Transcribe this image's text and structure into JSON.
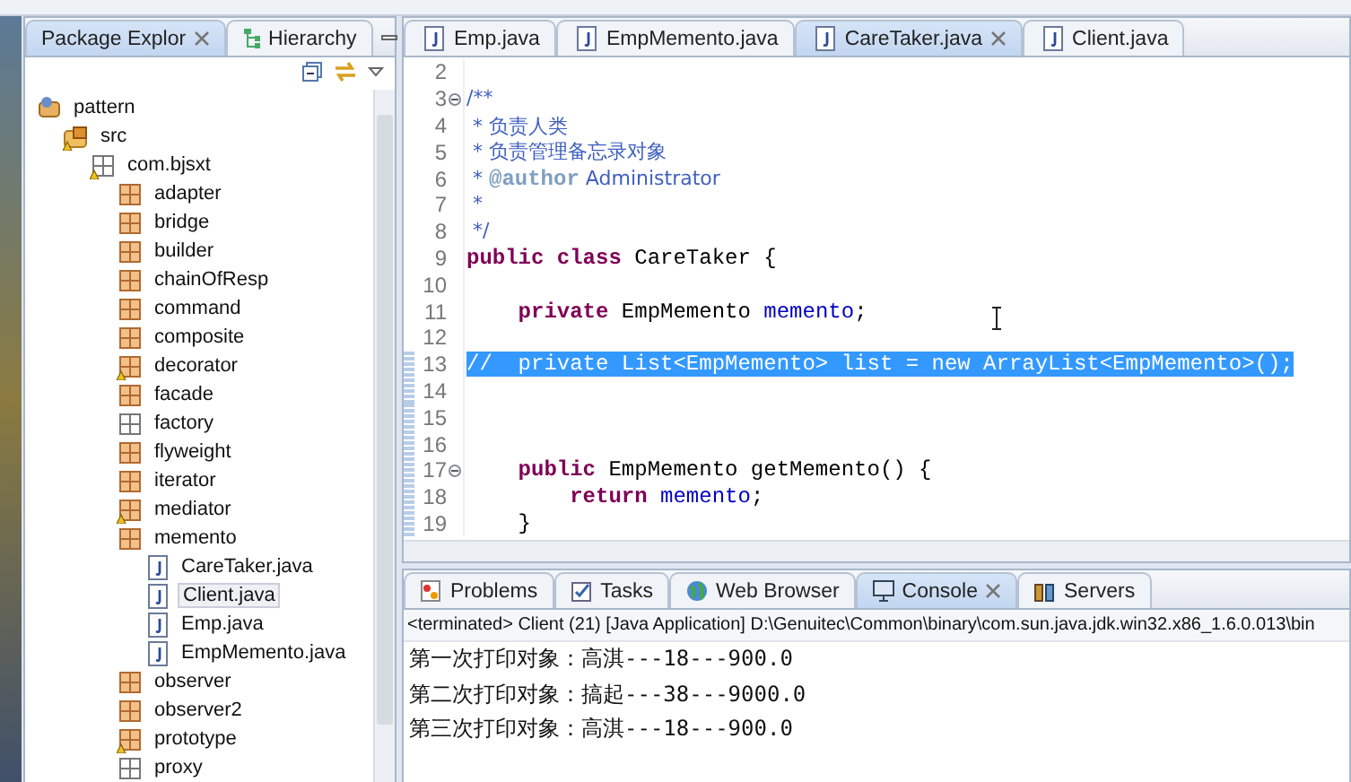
{
  "explorer": {
    "tabs": [
      {
        "label": "Package Explor",
        "selected": true,
        "closable": true
      },
      {
        "label": "Hierarchy",
        "selected": false,
        "closable": false
      }
    ],
    "tree": [
      {
        "label": "pattern",
        "kind": "project",
        "warning": false,
        "selected": false,
        "children": [
          {
            "label": "src",
            "kind": "source-folder",
            "warning": true,
            "selected": false,
            "children": [
              {
                "label": "com.bjsxt",
                "kind": "empty-package",
                "warning": true,
                "selected": false,
                "children": [
                  {
                    "label": "adapter",
                    "kind": "package",
                    "warning": false,
                    "selected": false
                  },
                  {
                    "label": "bridge",
                    "kind": "package",
                    "warning": false,
                    "selected": false
                  },
                  {
                    "label": "builder",
                    "kind": "package",
                    "warning": false,
                    "selected": false
                  },
                  {
                    "label": "chainOfResp",
                    "kind": "package",
                    "warning": false,
                    "selected": false
                  },
                  {
                    "label": "command",
                    "kind": "package",
                    "warning": false,
                    "selected": false
                  },
                  {
                    "label": "composite",
                    "kind": "package",
                    "warning": false,
                    "selected": false
                  },
                  {
                    "label": "decorator",
                    "kind": "package",
                    "warning": true,
                    "selected": false
                  },
                  {
                    "label": "facade",
                    "kind": "package",
                    "warning": false,
                    "selected": false
                  },
                  {
                    "label": "factory",
                    "kind": "empty-package",
                    "warning": false,
                    "selected": false
                  },
                  {
                    "label": "flyweight",
                    "kind": "package",
                    "warning": false,
                    "selected": false
                  },
                  {
                    "label": "iterator",
                    "kind": "package",
                    "warning": false,
                    "selected": false
                  },
                  {
                    "label": "mediator",
                    "kind": "package",
                    "warning": true,
                    "selected": false
                  },
                  {
                    "label": "memento",
                    "kind": "package",
                    "warning": false,
                    "selected": false,
                    "children": [
                      {
                        "label": "CareTaker.java",
                        "kind": "file",
                        "warning": false,
                        "selected": false
                      },
                      {
                        "label": "Client.java",
                        "kind": "file",
                        "warning": false,
                        "selected": true
                      },
                      {
                        "label": "Emp.java",
                        "kind": "file",
                        "warning": false,
                        "selected": false
                      },
                      {
                        "label": "EmpMemento.java",
                        "kind": "file",
                        "warning": false,
                        "selected": false
                      }
                    ]
                  },
                  {
                    "label": "observer",
                    "kind": "package",
                    "warning": false,
                    "selected": false
                  },
                  {
                    "label": "observer2",
                    "kind": "package",
                    "warning": false,
                    "selected": false
                  },
                  {
                    "label": "prototype",
                    "kind": "package",
                    "warning": true,
                    "selected": false
                  },
                  {
                    "label": "proxy",
                    "kind": "empty-package",
                    "warning": false,
                    "selected": false
                  }
                ]
              }
            ]
          }
        ]
      }
    ]
  },
  "editor": {
    "tabs": [
      {
        "label": "Emp.java",
        "selected": false,
        "closable": false
      },
      {
        "label": "EmpMemento.java",
        "selected": false,
        "closable": false
      },
      {
        "label": "CareTaker.java",
        "selected": true,
        "closable": true
      },
      {
        "label": "Client.java",
        "selected": false,
        "closable": false
      }
    ],
    "lines": [
      {
        "number": "2",
        "fold": false,
        "selected": false,
        "changed": false
      },
      {
        "number": "3",
        "fold": true,
        "selected": false,
        "changed": false,
        "segments": [
          {
            "kind": "javadoc",
            "text": "/**"
          }
        ]
      },
      {
        "number": "4",
        "fold": false,
        "selected": false,
        "changed": false,
        "segments": [
          {
            "kind": "javadoc",
            "text": " * 负责人类"
          }
        ]
      },
      {
        "number": "5",
        "fold": false,
        "selected": false,
        "changed": false,
        "segments": [
          {
            "kind": "javadoc",
            "text": " * 负责管理备忘录对象"
          }
        ]
      },
      {
        "number": "6",
        "fold": false,
        "selected": false,
        "changed": false,
        "segments": [
          {
            "kind": "javadoc",
            "text": " * "
          },
          {
            "kind": "tag",
            "text": "@author"
          },
          {
            "kind": "javadoc",
            "text": " Administrator"
          }
        ]
      },
      {
        "number": "7",
        "fold": false,
        "selected": false,
        "changed": false,
        "segments": [
          {
            "kind": "javadoc",
            "text": " *"
          }
        ]
      },
      {
        "number": "8",
        "fold": false,
        "selected": false,
        "changed": false,
        "segments": [
          {
            "kind": "javadoc",
            "text": " */"
          }
        ]
      },
      {
        "number": "9",
        "fold": false,
        "selected": false,
        "changed": false,
        "segments": [
          {
            "kind": "keyword",
            "text": "public class"
          },
          {
            "kind": "plain",
            "text": " CareTaker {"
          }
        ]
      },
      {
        "number": "10",
        "fold": false,
        "selected": false,
        "changed": false
      },
      {
        "number": "11",
        "fold": false,
        "selected": false,
        "changed": false,
        "segments": [
          {
            "kind": "keyword",
            "text": "    private"
          },
          {
            "kind": "plain",
            "text": " EmpMemento "
          },
          {
            "kind": "field",
            "text": "memento"
          },
          {
            "kind": "plain",
            "text": ";"
          }
        ]
      },
      {
        "number": "12",
        "fold": false,
        "selected": false,
        "changed": false
      },
      {
        "number": "13",
        "fold": false,
        "selected": true,
        "changed": true,
        "segments": [
          {
            "kind": "comment",
            "text": "//  private List<EmpMemento> list = new ArrayList<EmpMemento>();"
          }
        ]
      },
      {
        "number": "14",
        "fold": false,
        "selected": false,
        "changed": true
      },
      {
        "number": "15",
        "fold": false,
        "selected": false,
        "changed": true
      },
      {
        "number": "16",
        "fold": false,
        "selected": false,
        "changed": true
      },
      {
        "number": "17",
        "fold": true,
        "selected": false,
        "changed": true,
        "segments": [
          {
            "kind": "keyword",
            "text": "    public"
          },
          {
            "kind": "plain",
            "text": " EmpMemento getMemento() {"
          }
        ]
      },
      {
        "number": "18",
        "fold": false,
        "selected": false,
        "changed": true,
        "segments": [
          {
            "kind": "keyword",
            "text": "        return"
          },
          {
            "kind": "field",
            "text": " memento"
          },
          {
            "kind": "plain",
            "text": ";"
          }
        ]
      },
      {
        "number": "19",
        "fold": false,
        "selected": false,
        "changed": true,
        "segments": [
          {
            "kind": "plain",
            "text": "    }"
          }
        ]
      }
    ]
  },
  "console": {
    "tabs": [
      {
        "label": "Problems",
        "selected": false,
        "closable": false
      },
      {
        "label": "Tasks",
        "selected": false,
        "closable": false
      },
      {
        "label": "Web Browser",
        "selected": false,
        "closable": false
      },
      {
        "label": "Console",
        "selected": true,
        "closable": true
      },
      {
        "label": "Servers",
        "selected": false,
        "closable": false
      }
    ],
    "status": "<terminated> Client (21) [Java Application] D:\\Genuitec\\Common\\binary\\com.sun.java.jdk.win32.x86_1.6.0.013\\bin",
    "output": [
      "第一次打印对象：高淇---18---900.0",
      "第二次打印对象：搞起---38---9000.0",
      "第三次打印对象：高淇---18---900.0"
    ]
  }
}
